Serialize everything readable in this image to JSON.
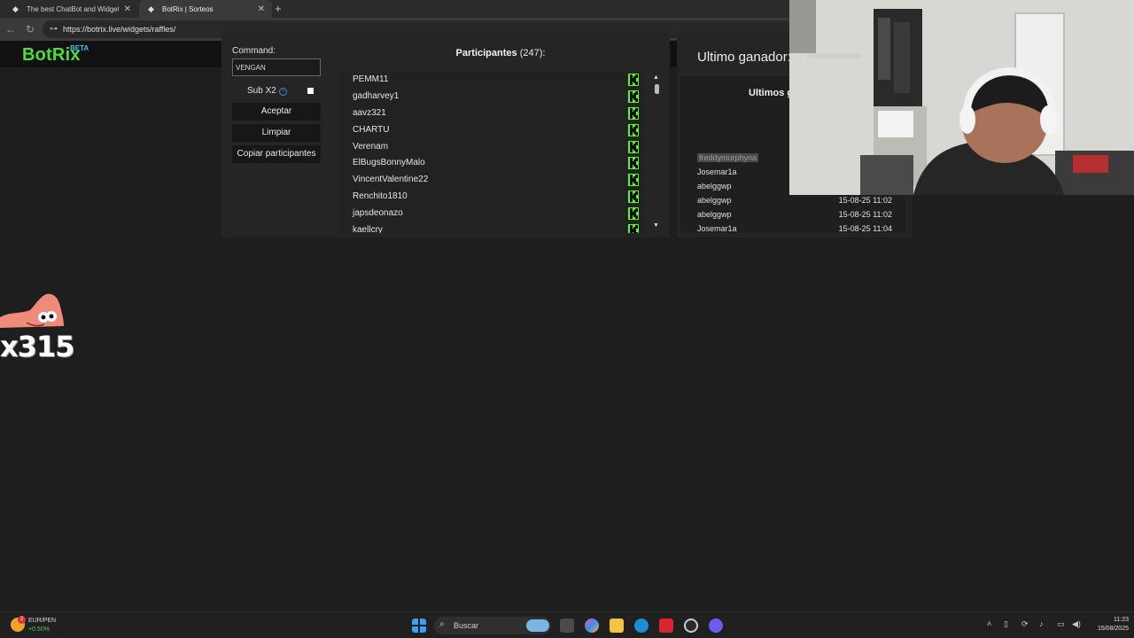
{
  "browser": {
    "tabs": [
      {
        "title": "The best ChatBot and Widgets fo",
        "active": false
      },
      {
        "title": "BotRix | Sorteos",
        "active": true
      }
    ],
    "url": "https://botrix.live/widgets/raffles/"
  },
  "brand": {
    "name": "BotRix",
    "badge": "BETA",
    "color": "#4ddc3a",
    "badge_color": "#35c6e8"
  },
  "controls": {
    "command_label": "Command:",
    "command_value": "VENGAN",
    "sub_label": "Sub X2",
    "sub_checked": false,
    "accept_label": "Aceptar",
    "clear_label": "Limpiar",
    "copy_label": "Copiar participantes"
  },
  "participants": {
    "title": "Participantes",
    "count": "(247):",
    "items": [
      "PEMM11",
      "gadharvey1",
      "aavz321",
      "CHARTU",
      "Verenam",
      "ElBugsBonnyMalo",
      "VincentValentine22",
      "Renchito1810",
      "japsdeonazo",
      "kaellcry"
    ],
    "platform_icon": "kick-icon",
    "platform_color": "#53fc18"
  },
  "winners": {
    "title": "Ultimo ganador:",
    "last_title": "Ultimos g",
    "rows": [
      {
        "name": "freddymurphyna",
        "date": ""
      },
      {
        "name": "Josemar1a",
        "date": ""
      },
      {
        "name": "abelggwp",
        "date": ""
      },
      {
        "name": "abelggwp",
        "date": "15-08-25 11:02"
      },
      {
        "name": "abelggwp",
        "date": "15-08-25 11:02"
      },
      {
        "name": "Josemar1a",
        "date": "15-08-25 11:04"
      }
    ]
  },
  "overlay": {
    "sticker_text": "x315"
  },
  "taskbar": {
    "ticker_name": "EUR/PEN",
    "ticker_change": "+0.50%",
    "weather_badge": "2",
    "search_label": "Buscar",
    "time": "11:23",
    "date": "15/08/2025"
  }
}
